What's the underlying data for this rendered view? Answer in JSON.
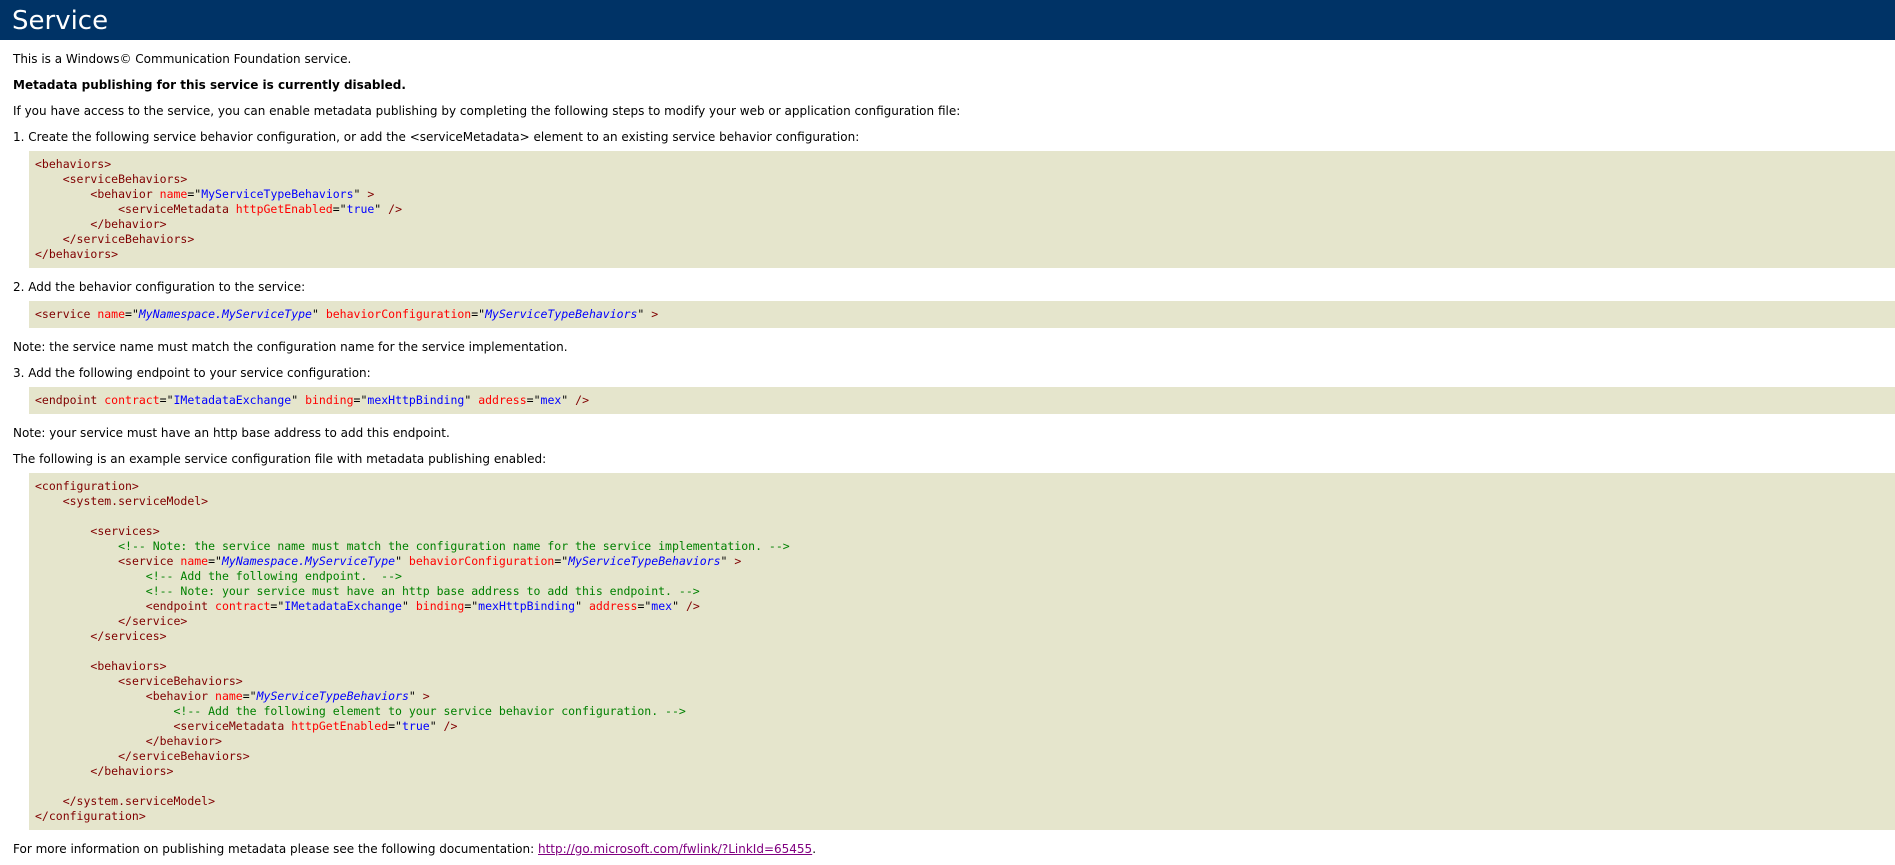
{
  "header": {
    "title": "Service"
  },
  "intro": {
    "wcf_line": "This is a Windows© Communication Foundation service.",
    "disabled": "Metadata publishing for this service is currently disabled.",
    "access": "If you have access to the service, you can enable metadata publishing by completing the following steps to modify your web or application configuration file:"
  },
  "step1": {
    "text": "1. Create the following service behavior configuration, or add the <serviceMetadata> element to an existing service behavior configuration:",
    "code": [
      [
        [
          "t",
          "<behaviors>"
        ]
      ],
      [
        [
          "s",
          "    "
        ],
        [
          "t",
          "<serviceBehaviors>"
        ]
      ],
      [
        [
          "s",
          "        "
        ],
        [
          "t",
          "<behavior "
        ],
        [
          "a",
          "name"
        ],
        [
          "q",
          "=\""
        ],
        [
          "v",
          "MyServiceTypeBehaviors"
        ],
        [
          "q",
          "\" "
        ],
        [
          "t",
          ">"
        ]
      ],
      [
        [
          "s",
          "            "
        ],
        [
          "t",
          "<serviceMetadata "
        ],
        [
          "a",
          "httpGetEnabled"
        ],
        [
          "q",
          "=\""
        ],
        [
          "v",
          "true"
        ],
        [
          "q",
          "\" "
        ],
        [
          "t",
          "/>"
        ]
      ],
      [
        [
          "s",
          "        "
        ],
        [
          "t",
          "</behavior>"
        ]
      ],
      [
        [
          "s",
          "    "
        ],
        [
          "t",
          "</serviceBehaviors>"
        ]
      ],
      [
        [
          "t",
          "</behaviors>"
        ]
      ]
    ]
  },
  "step2": {
    "text": "2. Add the behavior configuration to the service:",
    "code": [
      [
        [
          "t",
          "<service "
        ],
        [
          "a",
          "name"
        ],
        [
          "q",
          "=\""
        ],
        [
          "vi",
          "MyNamespace.MyServiceType"
        ],
        [
          "q",
          "\" "
        ],
        [
          "a",
          "behaviorConfiguration"
        ],
        [
          "q",
          "=\""
        ],
        [
          "vi",
          "MyServiceTypeBehaviors"
        ],
        [
          "q",
          "\" "
        ],
        [
          "t",
          ">"
        ]
      ]
    ]
  },
  "note1": "Note: the service name must match the configuration name for the service implementation.",
  "step3": {
    "text": "3. Add the following endpoint to your service configuration:",
    "code": [
      [
        [
          "t",
          "<endpoint "
        ],
        [
          "a",
          "contract"
        ],
        [
          "q",
          "=\""
        ],
        [
          "v",
          "IMetadataExchange"
        ],
        [
          "q",
          "\" "
        ],
        [
          "a",
          "binding"
        ],
        [
          "q",
          "=\""
        ],
        [
          "v",
          "mexHttpBinding"
        ],
        [
          "q",
          "\" "
        ],
        [
          "a",
          "address"
        ],
        [
          "q",
          "=\""
        ],
        [
          "v",
          "mex"
        ],
        [
          "q",
          "\" "
        ],
        [
          "t",
          "/>"
        ]
      ]
    ]
  },
  "note2": "Note: your service must have an http base address to add this endpoint.",
  "example": {
    "text": "The following is an example service configuration file with metadata publishing enabled:",
    "code": [
      [
        [
          "t",
          "<configuration>"
        ]
      ],
      [
        [
          "s",
          "    "
        ],
        [
          "t",
          "<system.serviceModel>"
        ]
      ],
      [],
      [
        [
          "s",
          "        "
        ],
        [
          "t",
          "<services>"
        ]
      ],
      [
        [
          "s",
          "            "
        ],
        [
          "c",
          "<!-- Note: the service name must match the configuration name for the service implementation. -->"
        ]
      ],
      [
        [
          "s",
          "            "
        ],
        [
          "t",
          "<service "
        ],
        [
          "a",
          "name"
        ],
        [
          "q",
          "=\""
        ],
        [
          "vi",
          "MyNamespace.MyServiceType"
        ],
        [
          "q",
          "\" "
        ],
        [
          "a",
          "behaviorConfiguration"
        ],
        [
          "q",
          "=\""
        ],
        [
          "vi",
          "MyServiceTypeBehaviors"
        ],
        [
          "q",
          "\" "
        ],
        [
          "t",
          ">"
        ]
      ],
      [
        [
          "s",
          "                "
        ],
        [
          "c",
          "<!-- Add the following endpoint.  -->"
        ]
      ],
      [
        [
          "s",
          "                "
        ],
        [
          "c",
          "<!-- Note: your service must have an http base address to add this endpoint. -->"
        ]
      ],
      [
        [
          "s",
          "                "
        ],
        [
          "t",
          "<endpoint "
        ],
        [
          "a",
          "contract"
        ],
        [
          "q",
          "=\""
        ],
        [
          "v",
          "IMetadataExchange"
        ],
        [
          "q",
          "\" "
        ],
        [
          "a",
          "binding"
        ],
        [
          "q",
          "=\""
        ],
        [
          "v",
          "mexHttpBinding"
        ],
        [
          "q",
          "\" "
        ],
        [
          "a",
          "address"
        ],
        [
          "q",
          "=\""
        ],
        [
          "v",
          "mex"
        ],
        [
          "q",
          "\" "
        ],
        [
          "t",
          "/>"
        ]
      ],
      [
        [
          "s",
          "            "
        ],
        [
          "t",
          "</service>"
        ]
      ],
      [
        [
          "s",
          "        "
        ],
        [
          "t",
          "</services>"
        ]
      ],
      [],
      [
        [
          "s",
          "        "
        ],
        [
          "t",
          "<behaviors>"
        ]
      ],
      [
        [
          "s",
          "            "
        ],
        [
          "t",
          "<serviceBehaviors>"
        ]
      ],
      [
        [
          "s",
          "                "
        ],
        [
          "t",
          "<behavior "
        ],
        [
          "a",
          "name"
        ],
        [
          "q",
          "=\""
        ],
        [
          "vi",
          "MyServiceTypeBehaviors"
        ],
        [
          "q",
          "\" "
        ],
        [
          "t",
          ">"
        ]
      ],
      [
        [
          "s",
          "                    "
        ],
        [
          "c",
          "<!-- Add the following element to your service behavior configuration. -->"
        ]
      ],
      [
        [
          "s",
          "                    "
        ],
        [
          "t",
          "<serviceMetadata "
        ],
        [
          "a",
          "httpGetEnabled"
        ],
        [
          "q",
          "=\""
        ],
        [
          "v",
          "true"
        ],
        [
          "q",
          "\" "
        ],
        [
          "t",
          "/>"
        ]
      ],
      [
        [
          "s",
          "                "
        ],
        [
          "t",
          "</behavior>"
        ]
      ],
      [
        [
          "s",
          "            "
        ],
        [
          "t",
          "</serviceBehaviors>"
        ]
      ],
      [
        [
          "s",
          "        "
        ],
        [
          "t",
          "</behaviors>"
        ]
      ],
      [],
      [
        [
          "s",
          "    "
        ],
        [
          "t",
          "</system.serviceModel>"
        ]
      ],
      [
        [
          "t",
          "</configuration>"
        ]
      ]
    ]
  },
  "footer": {
    "text": "For more information on publishing metadata please see the following documentation: ",
    "link_text": "http://go.microsoft.com/fwlink/?LinkId=65455",
    "end": "."
  }
}
